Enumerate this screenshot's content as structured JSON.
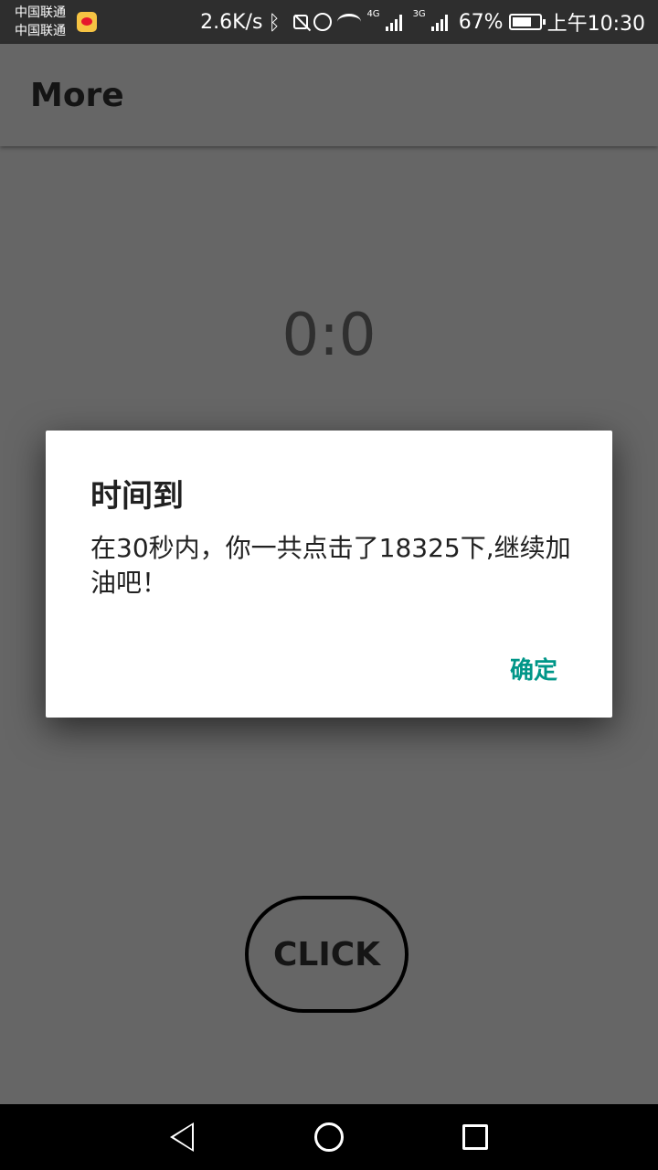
{
  "status_bar": {
    "carrier_1": "中国联通",
    "carrier_2": "中国联通",
    "speed": "2.6K/s",
    "net_1": "4G",
    "net_2": "3G",
    "battery": "67%",
    "time": "上午10:30"
  },
  "app_bar": {
    "title": "More"
  },
  "main": {
    "timer": "0:0",
    "click_label": "CLICK"
  },
  "dialog": {
    "title": "时间到",
    "message": "在30秒内，你一共点击了18325下,继续加油吧！",
    "confirm_label": "确定",
    "accent_color": "#009688"
  }
}
